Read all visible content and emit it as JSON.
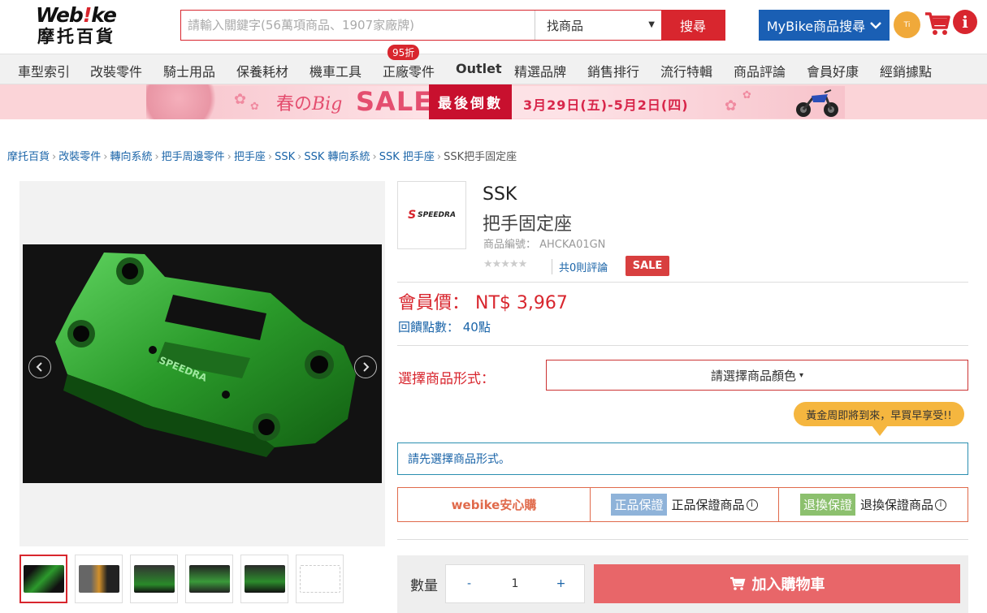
{
  "header": {
    "logo_top_pre": "Web",
    "logo_top_bang": "!",
    "logo_top_post": "ke",
    "logo_bottom": "摩托百貨",
    "search_placeholder": "請輸入關鍵字(56萬項商品、1907家廠牌)",
    "search_scope": "找商品",
    "search_button": "搜尋",
    "mybike_button": "MyBike商品搜尋",
    "avatar_initials": "Ti"
  },
  "nav": {
    "items": [
      "車型索引",
      "改裝零件",
      "騎士用品",
      "保養耗材",
      "機車工具",
      "正廠零件",
      "Outlet",
      "精選品牌",
      "銷售排行",
      "流行特輯",
      "商品評論",
      "會員好康",
      "經銷據點"
    ],
    "badge": "95折"
  },
  "banner": {
    "title_pre": "春の",
    "title_big": "Big",
    "sale": "SALE",
    "last": "最後倒數",
    "dates": "3月29日(五)-5月2日(四)"
  },
  "breadcrumb": [
    "摩托百貨",
    "改裝零件",
    "轉向系統",
    "把手周邊零件",
    "把手座",
    "SSK",
    "SSK 轉向系統",
    "SSK 把手座"
  ],
  "breadcrumb_current": "SSK把手固定座",
  "product": {
    "brand": "SSK",
    "name": "把手固定座",
    "code": "商品編號： AHCKA01GN",
    "stars": "★★★★★",
    "reviews": "共0則評論",
    "sale_badge": "SALE",
    "brand_logo_text": "SPEEDRA",
    "price": "會員價： NT$ 3,967",
    "points": "回饋點數： 40點",
    "option_label": "選擇商品形式：",
    "option_select": "請選擇商品顏色",
    "promo": "黃金周即將到來，早買早享受!!",
    "notice": "請先選擇商品形式。",
    "guarantee_title": "webike安心購",
    "guarantee_tag1": "正品保證",
    "guarantee_text1": "正品保證商品",
    "guarantee_tag2": "退換保證",
    "guarantee_text2": "退換保證商品",
    "info_glyph": "i",
    "qty_label": "數量",
    "qty_minus": "-",
    "qty_value": "1",
    "qty_plus": "+",
    "add_cart": "加入購物車",
    "photo_text": "SPEEDRA"
  },
  "colors": {
    "brand_red": "#d8262e",
    "link_blue": "#1a64a8",
    "mybike_blue": "#1a5fb4",
    "cart_button": "#e86669",
    "product_green": "#2f9a2f"
  },
  "icons": {
    "cart": "cart-icon",
    "info": "info-icon",
    "chevron": "chevron-down-icon",
    "prev": "chevron-left-icon",
    "next": "chevron-right-icon"
  }
}
